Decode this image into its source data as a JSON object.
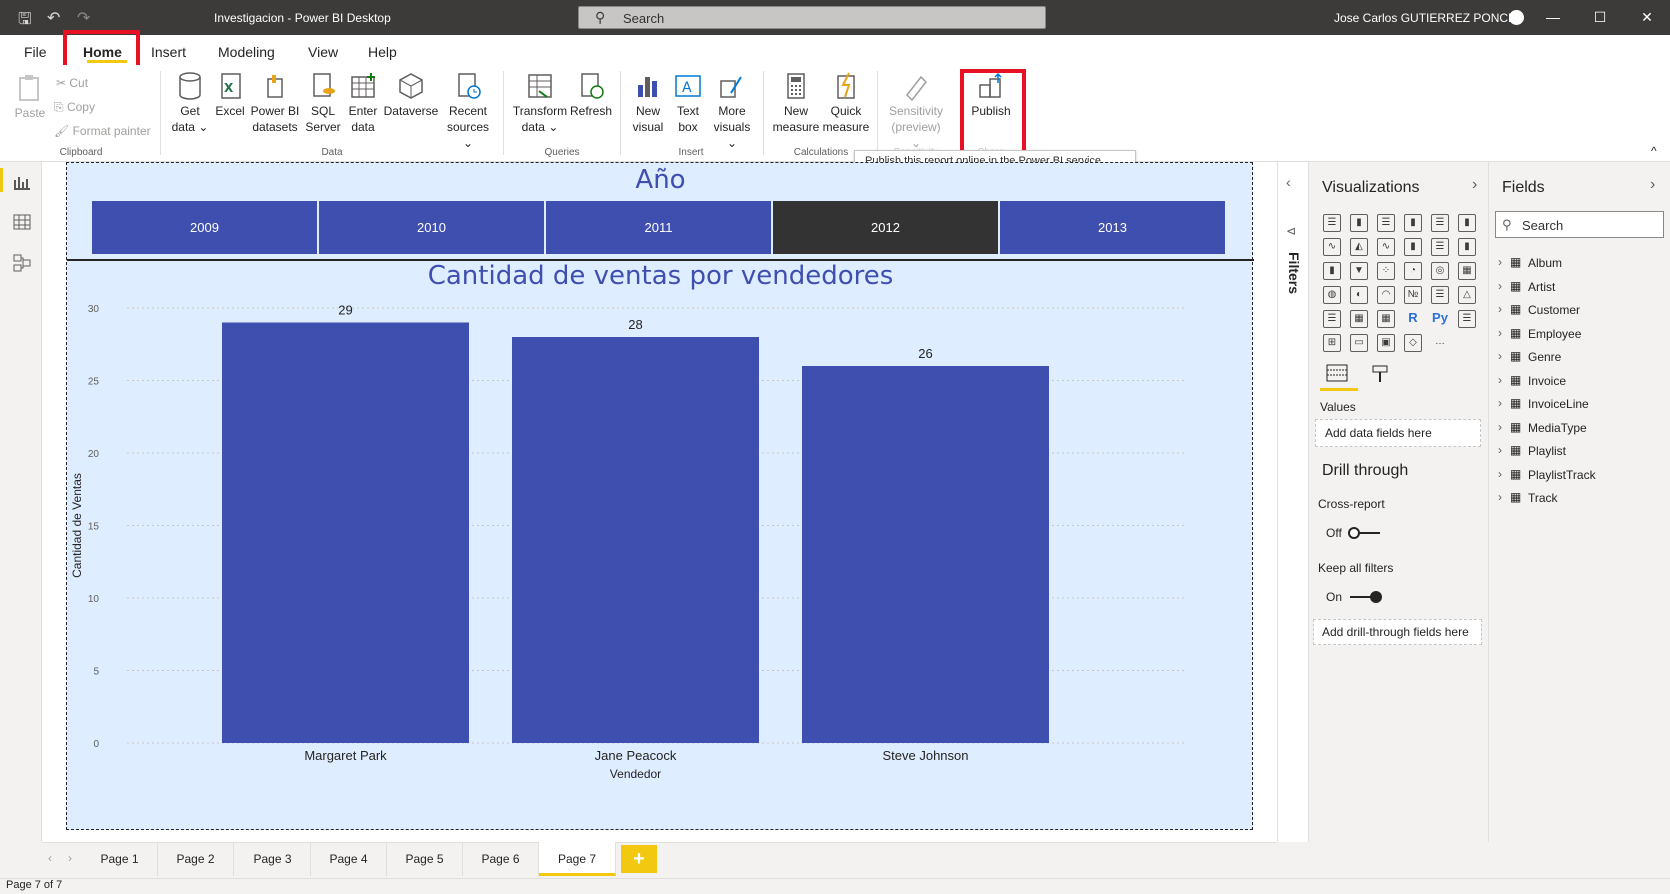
{
  "titlebar": {
    "title": "Investigacion - Power BI Desktop",
    "search_placeholder": "Search",
    "user": "Jose Carlos GUTIERREZ PONCE"
  },
  "menu": [
    "File",
    "Home",
    "Insert",
    "Modeling",
    "View",
    "Help"
  ],
  "ribbon": {
    "clipboard": {
      "paste": "Paste",
      "cut": "Cut",
      "copy": "Copy",
      "format_painter": "Format painter",
      "group": "Clipboard"
    },
    "data": {
      "buttons": [
        {
          "l1": "Get",
          "l2": "data ⌄"
        },
        {
          "l1": "Excel",
          "l2": ""
        },
        {
          "l1": "Power BI",
          "l2": "datasets"
        },
        {
          "l1": "SQL",
          "l2": "Server"
        },
        {
          "l1": "Enter",
          "l2": "data"
        },
        {
          "l1": "Dataverse",
          "l2": ""
        },
        {
          "l1": "Recent",
          "l2": "sources ⌄"
        }
      ],
      "group": "Data"
    },
    "queries": {
      "transform_l1": "Transform",
      "transform_l2": "data ⌄",
      "refresh": "Refresh",
      "group": "Queries"
    },
    "insert": {
      "new_visual_l1": "New",
      "new_visual_l2": "visual",
      "text_box_l1": "Text",
      "text_box_l2": "box",
      "more_l1": "More",
      "more_l2": "visuals ⌄",
      "group": "Insert"
    },
    "calculations": {
      "new_measure_l1": "New",
      "new_measure_l2": "measure",
      "quick_l1": "Quick",
      "quick_l2": "measure",
      "group": "Calculations"
    },
    "sensitivity": {
      "l1": "Sensitivity",
      "l2": "(preview) ⌄",
      "group": "Sensitivity"
    },
    "share": {
      "publish": "Publish",
      "group": "Share"
    },
    "tooltip": "Publish this report online in the Power BI service."
  },
  "slicer": {
    "title": "Año",
    "years": [
      "2009",
      "2010",
      "2011",
      "2012",
      "2013"
    ],
    "selected": "2012"
  },
  "chart_data": {
    "type": "bar",
    "title": "Cantidad de ventas por vendedores",
    "categories": [
      "Margaret Park",
      "Jane Peacock",
      "Steve Johnson"
    ],
    "values": [
      29,
      28,
      26
    ],
    "xlabel": "Vendedor",
    "ylabel": "Cantidad de Ventas",
    "ylim": [
      0,
      30
    ],
    "yticks": [
      0,
      5,
      10,
      15,
      20,
      25,
      30
    ],
    "grid": true,
    "bar_color": "#3f4fb0"
  },
  "filters": {
    "label": "Filters"
  },
  "visualizations": {
    "title": "Visualizations",
    "values_label": "Values",
    "values_well": "Add data fields here",
    "drill_title": "Drill through",
    "cross_report": "Cross-report",
    "cross_report_state": "Off",
    "keep_filters": "Keep all filters",
    "keep_filters_state": "On",
    "drill_well": "Add drill-through fields here"
  },
  "fields": {
    "title": "Fields",
    "search_placeholder": "Search",
    "tables": [
      "Album",
      "Artist",
      "Customer",
      "Employee",
      "Genre",
      "Invoice",
      "InvoiceLine",
      "MediaType",
      "Playlist",
      "PlaylistTrack",
      "Track"
    ]
  },
  "pages": [
    "Page 1",
    "Page 2",
    "Page 3",
    "Page 4",
    "Page 5",
    "Page 6",
    "Page 7"
  ],
  "active_page": "Page 7",
  "status": "Page 7 of 7",
  "colors": {
    "accent": "#f2c811",
    "bar": "#3f4fb0",
    "highlight": "#e81123"
  }
}
